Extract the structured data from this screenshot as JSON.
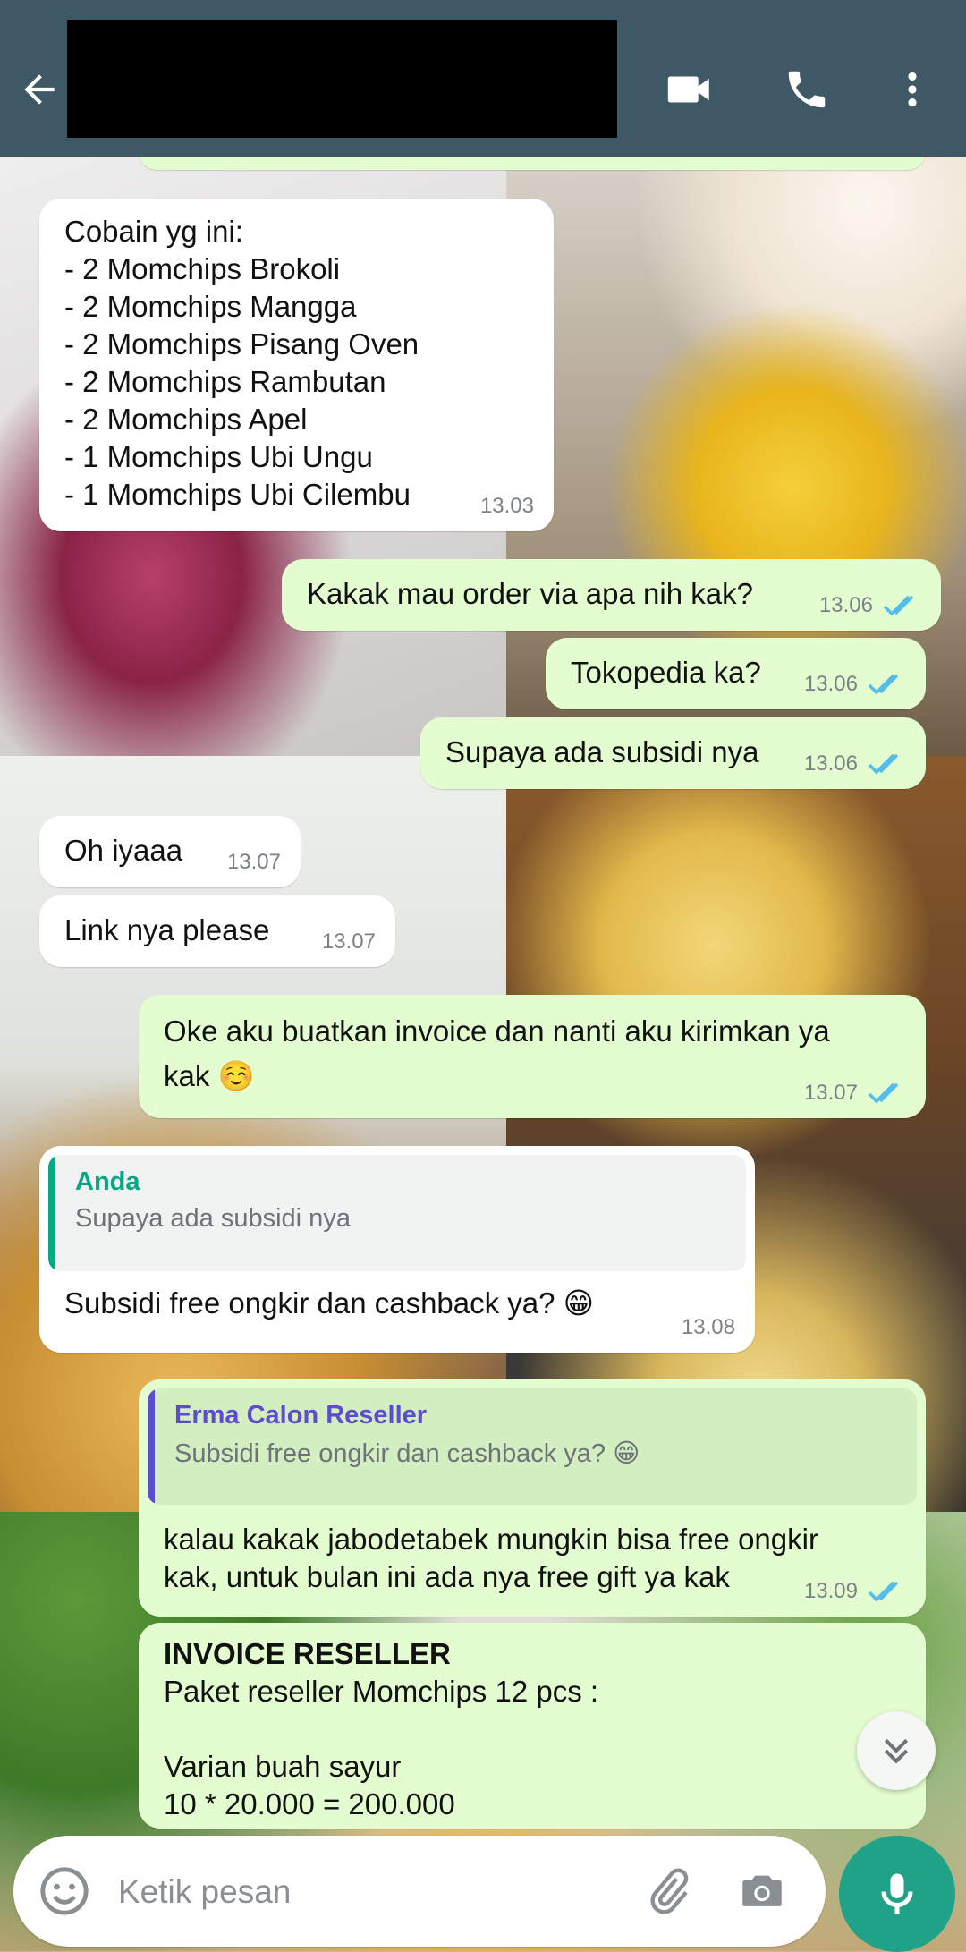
{
  "header": {
    "back_icon": "arrow-left-icon",
    "video_icon": "videocam-icon",
    "call_icon": "phone-icon",
    "menu_icon": "more-vert-icon",
    "background": "#3f5866"
  },
  "messages": [
    {
      "direction": "in",
      "text": "Cobain yg ini:\n- 2 Momchips Brokoli\n- 2 Momchips Mangga\n- 2 Momchips Pisang Oven\n- 2 Momchips Rambutan\n- 2 Momchips Apel\n- 1 Momchips Ubi Ungu\n- 1 Momchips Ubi Cilembu",
      "time": "13.03"
    },
    {
      "direction": "out",
      "text": "Kakak mau order via apa nih kak?",
      "time": "13.06",
      "status": "read"
    },
    {
      "direction": "out",
      "text": "Tokopedia ka?",
      "time": "13.06",
      "status": "read"
    },
    {
      "direction": "out",
      "text": "Supaya ada subsidi nya",
      "time": "13.06",
      "status": "read"
    },
    {
      "direction": "in",
      "text": "Oh iyaaa",
      "time": "13.07"
    },
    {
      "direction": "in",
      "text": "Link nya please",
      "time": "13.07"
    },
    {
      "direction": "out",
      "text": "Oke aku buatkan invoice dan nanti aku kirimkan ya\nkak ☺️",
      "time": "13.07",
      "status": "read"
    },
    {
      "direction": "in",
      "quote": {
        "name": "Anda",
        "text": "Supaya ada subsidi nya"
      },
      "text": "Subsidi free ongkir dan cashback ya? 😁",
      "time": "13.08"
    },
    {
      "direction": "out",
      "quote": {
        "name": "Erma Calon Reseller",
        "text": "Subsidi free ongkir dan cashback ya? 😁"
      },
      "text": "kalau kakak jabodetabek mungkin bisa free ongkir\nkak, untuk bulan ini ada nya free gift ya kak",
      "time": "13.09",
      "status": "read"
    },
    {
      "direction": "out",
      "title": "INVOICE RESELLER",
      "text": "Paket reseller Momchips 12 pcs :\n\nVarian buah sayur\n 10 * 20.000 = 200.000"
    }
  ],
  "colors": {
    "incoming_bubble": "#ffffff",
    "outgoing_bubble": "#e3fdd0",
    "read_tick": "#53bdeb",
    "quote_you": "#06a884",
    "quote_other": "#5d4ccf",
    "mic": "#1fa287"
  },
  "composer": {
    "placeholder": "Ketik pesan",
    "emoji_icon": "emoji-icon",
    "attach_icon": "paperclip-icon",
    "camera_icon": "camera-icon",
    "mic_icon": "mic-icon"
  },
  "scroll_icon": "double-chevron-down-icon"
}
